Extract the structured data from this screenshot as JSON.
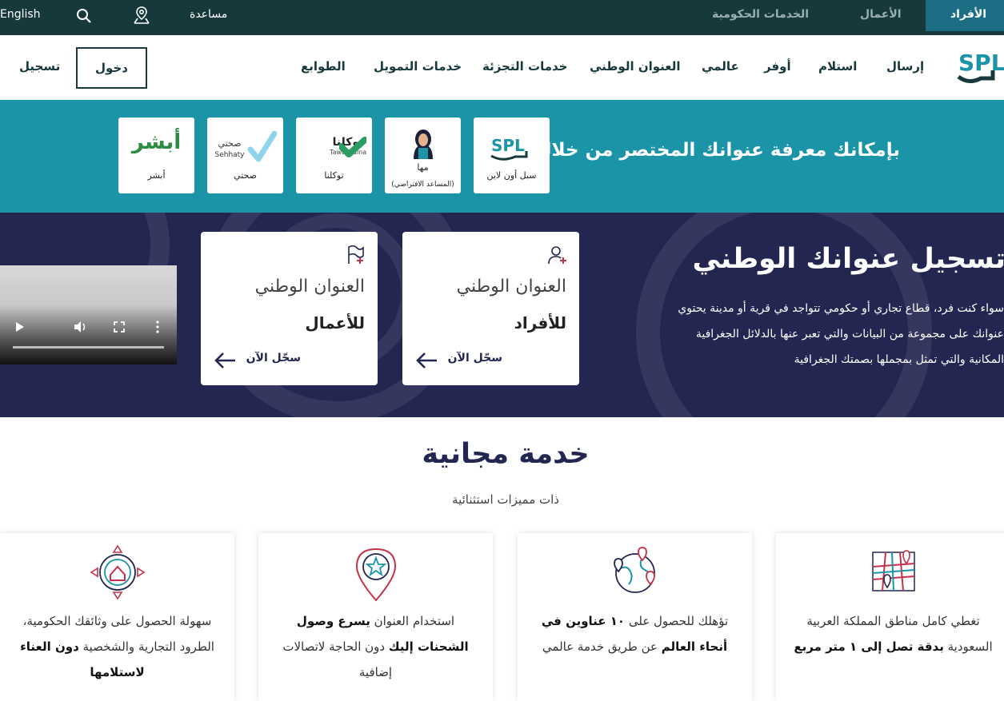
{
  "topbar": {
    "tabs": [
      "الأفراد",
      "الأعمال",
      "الخدمات الحكومية"
    ],
    "help": "مساعدة",
    "language": "English"
  },
  "nav": {
    "items": [
      "إرسال",
      "استلام",
      "أوفر",
      "عالمي",
      "العنوان الوطني",
      "خدمات التجزئة",
      "خدمات التمويل",
      "الطوابع"
    ],
    "login": "دخول",
    "register": "تسجيل",
    "logo_text": "SPL سبل"
  },
  "quick": {
    "headline": "بإمكانك معرفة عنوانك المختصر من خلال",
    "tiles": [
      {
        "label": "سبل أون لاين",
        "logo": "SPL سبل"
      },
      {
        "label": "مها",
        "sub": "(المساعد الافتراضي)"
      },
      {
        "label": "توكلنا",
        "logo": "توكلنا",
        "logo_sub": "Tawakkalna"
      },
      {
        "label": "صحتي",
        "logo": "صحتي",
        "logo_sub": "Sehhaty"
      },
      {
        "label": "أبشر",
        "logo": "أبشر"
      }
    ]
  },
  "hero": {
    "title": "تسجيل عنوانك الوطني",
    "desc_lines": [
      "سواء كنت فرد، قطاع تجاري أو حكومي تتواجد في قرية أو مدينة يحتوي",
      "عنوانك على مجموعة من البيانات والتي تعبر عنها بالدلائل الجغرافية",
      "المكانية والتي تمثل بمجملها بصمتك الجغرافية"
    ],
    "cards": [
      {
        "line1": "العنوان الوطني",
        "line2": "للأفراد",
        "cta": "سجّل الآن"
      },
      {
        "line1": "العنوان الوطني",
        "line2": "للأعمال",
        "cta": "سجّل الآن"
      }
    ]
  },
  "free": {
    "title": "خدمة مجانية",
    "subtitle": "ذات مميزات استثنائية",
    "features": [
      {
        "p1": "تغطي كامل مناطق المملكة العربية السعودية ",
        "b": "بدقة تصل إلى ١ متر مربع",
        "p2": ""
      },
      {
        "p1": "تؤهلك للحصول على ",
        "b": "١٠ عناوين في أنحاء العالم",
        "p2": " عن طريق خدمة عالمي"
      },
      {
        "p1": "استخدام العنوان ",
        "b": "يسرع وصول الشحنات إليك",
        "p2": " دون الحاجة لاتصالات إضافية"
      },
      {
        "p1": "سهولة الحصول على وثائقك الحكومية، الطرود التجارية والشخصية ",
        "b": "دون العناء لاستلامها",
        "p2": ""
      }
    ]
  },
  "colors": {
    "dark": "#17393c",
    "teal": "#1b94a8",
    "navy": "#232651",
    "accent": "#c8314a"
  }
}
